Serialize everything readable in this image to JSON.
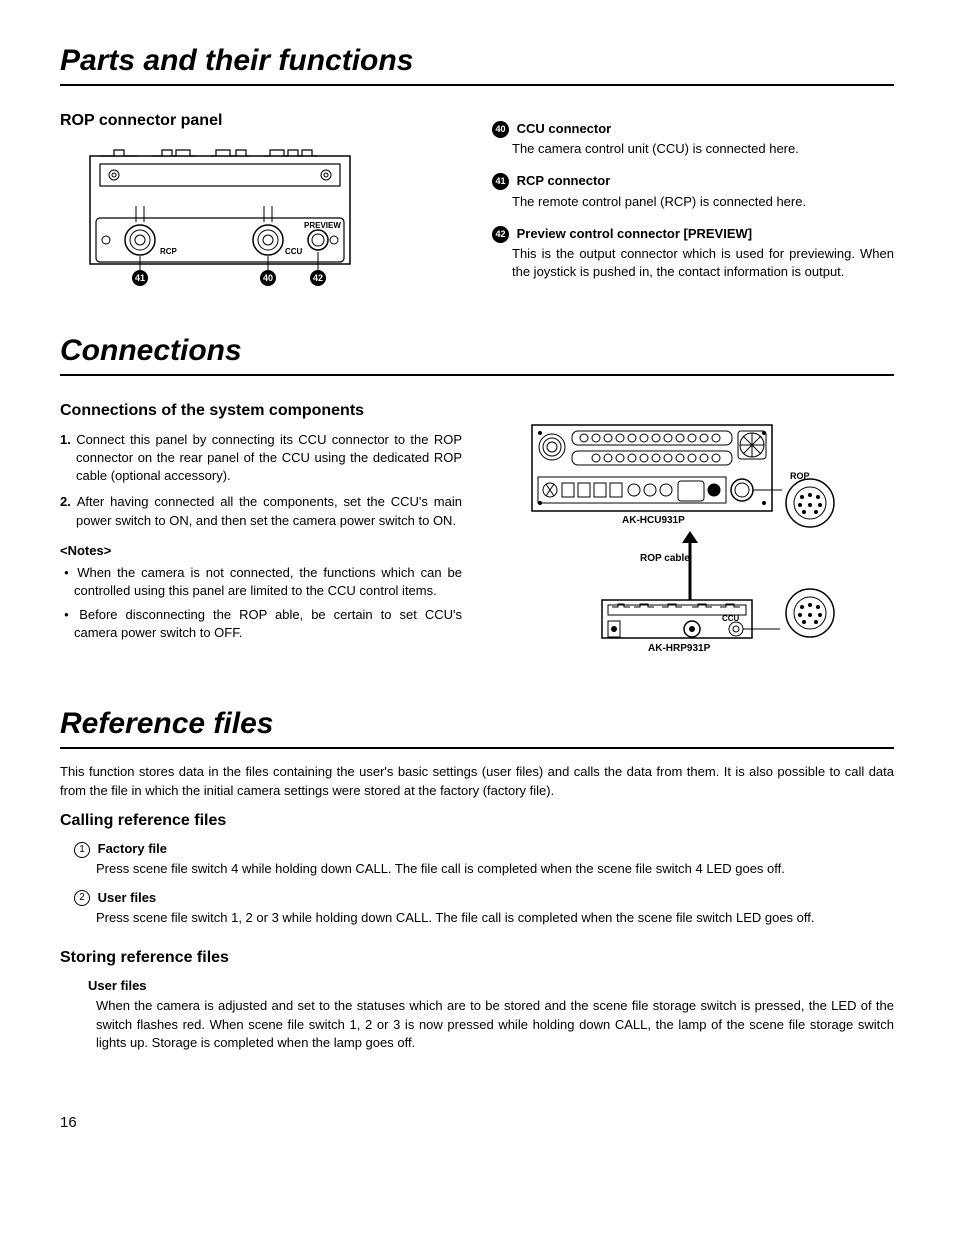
{
  "section1": {
    "title": "Parts and their functions",
    "subtitle": "ROP connector panel",
    "diagram": {
      "labels": {
        "rcp": "RCP",
        "ccu": "CCU",
        "preview": "PREVIEW"
      },
      "callouts": {
        "c41": "41",
        "c40": "40",
        "c42": "42"
      }
    },
    "items": [
      {
        "num": "40",
        "title": "CCU connector",
        "body": "The camera control unit (CCU) is connected here."
      },
      {
        "num": "41",
        "title": "RCP connector",
        "body": "The remote control panel (RCP) is connected here."
      },
      {
        "num": "42",
        "title": "Preview control connector [PREVIEW]",
        "body": "This is the output connector which is used for previewing. When the joystick is pushed in, the contact information is output."
      }
    ]
  },
  "section2": {
    "title": "Connections",
    "subtitle": "Connections of the system components",
    "steps": [
      "Connect this panel by connecting its CCU connector to the ROP connector on the rear panel of the CCU using the dedicated ROP cable (optional accessory).",
      "After having connected all the components, set the CCU's main power switch to ON, and then set the camera power switch to ON."
    ],
    "notes_title": "<Notes>",
    "notes": [
      "When the camera is not connected, the functions which can be controlled using this panel are limited to the CCU control items.",
      "Before disconnecting the ROP able, be certain to set CCU's camera power switch to OFF."
    ],
    "diagram": {
      "top_label": "AK-HCU931P",
      "cable_label": "ROP cable",
      "bottom_label": "AK-HRP931P",
      "rop_label": "ROP",
      "ccu_label": "CCU"
    }
  },
  "section3": {
    "title": "Reference files",
    "intro": "This function stores data in the files containing the user's basic settings (user files) and calls the data from them.  It is also possible to call data from the file in which the initial camera settings were stored at the factory (factory file).",
    "calling": {
      "subtitle": "Calling reference files",
      "items": [
        {
          "num": "1",
          "title": "Factory file",
          "body": "Press scene file switch 4 while holding down CALL.  The file call is completed when the scene file switch 4 LED goes off."
        },
        {
          "num": "2",
          "title": "User files",
          "body": "Press scene file switch 1, 2 or 3 while holding down CALL.  The file call is completed when the scene file switch LED goes off."
        }
      ]
    },
    "storing": {
      "subtitle": "Storing reference files",
      "item": {
        "title": "User files",
        "body": "When the camera is adjusted and set to the statuses which are to be stored and the scene file storage switch is pressed, the LED of the switch flashes red.  When scene file switch 1, 2 or 3 is now pressed while holding down CALL, the lamp of the scene file storage switch lights up.  Storage is completed when the lamp goes off."
      }
    }
  },
  "page_number": "16"
}
